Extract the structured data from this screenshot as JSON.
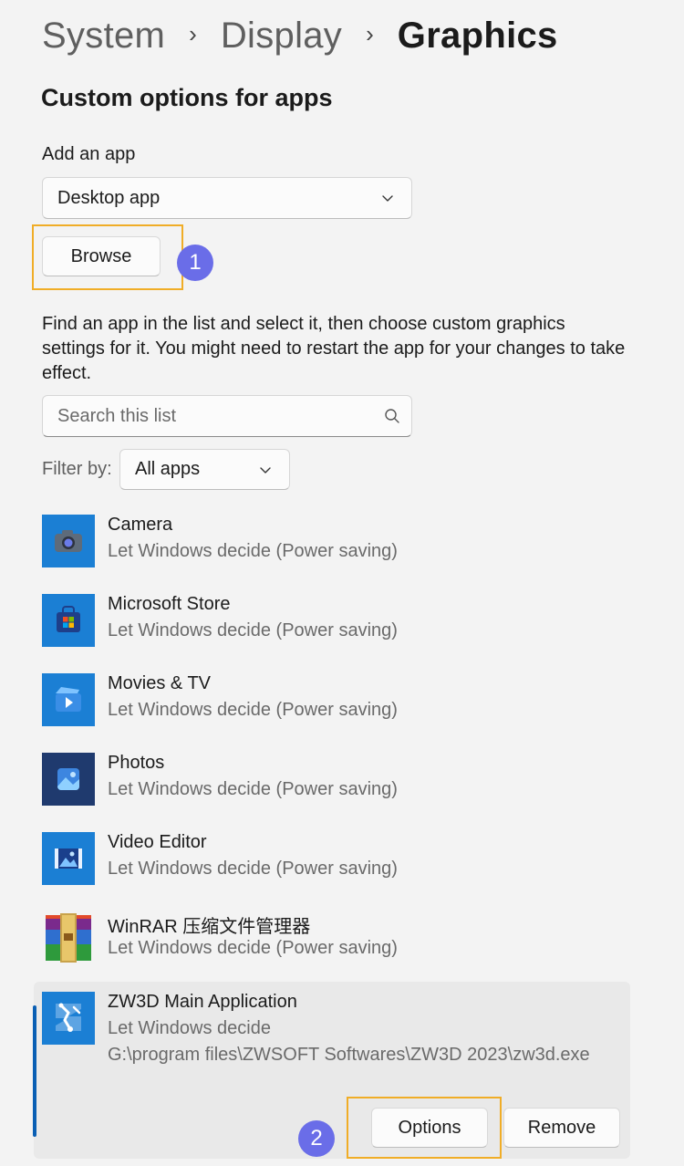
{
  "breadcrumb": {
    "items": [
      "System",
      "Display",
      "Graphics"
    ]
  },
  "section_title": "Custom options for apps",
  "add_app": {
    "label": "Add an app",
    "selected": "Desktop app",
    "browse_label": "Browse"
  },
  "description": "Find an app in the list and select it, then choose custom graphics settings for it. You might need to restart the app for your changes to take effect.",
  "search": {
    "placeholder": "Search this list",
    "icon": "search-icon"
  },
  "filter": {
    "label": "Filter by:",
    "selected": "All apps"
  },
  "apps": [
    {
      "name": "Camera",
      "status": "Let Windows decide (Power saving)",
      "icon": "camera-icon"
    },
    {
      "name": "Microsoft Store",
      "status": "Let Windows decide (Power saving)",
      "icon": "store-icon"
    },
    {
      "name": "Movies & TV",
      "status": "Let Windows decide (Power saving)",
      "icon": "movies-icon"
    },
    {
      "name": "Photos",
      "status": "Let Windows decide (Power saving)",
      "icon": "photos-icon"
    },
    {
      "name": "Video Editor",
      "status": "Let Windows decide (Power saving)",
      "icon": "video-editor-icon"
    },
    {
      "name": "WinRAR 压缩文件管理器",
      "status": "Let Windows decide (Power saving)",
      "icon": "winrar-icon"
    }
  ],
  "selected_app": {
    "name": "ZW3D Main Application",
    "status": "Let Windows decide",
    "path": "G:\\program files\\ZWSOFT Softwares\\ZW3D 2023\\zw3d.exe",
    "icon": "zw3d-icon",
    "options_label": "Options",
    "remove_label": "Remove"
  },
  "annotations": {
    "badge1": "1",
    "badge2": "2"
  },
  "colors": {
    "accent": "#0a5fb4",
    "highlight": "#f0ad27",
    "badge": "#6a6de8",
    "app_tile": "#1b7fd4"
  }
}
